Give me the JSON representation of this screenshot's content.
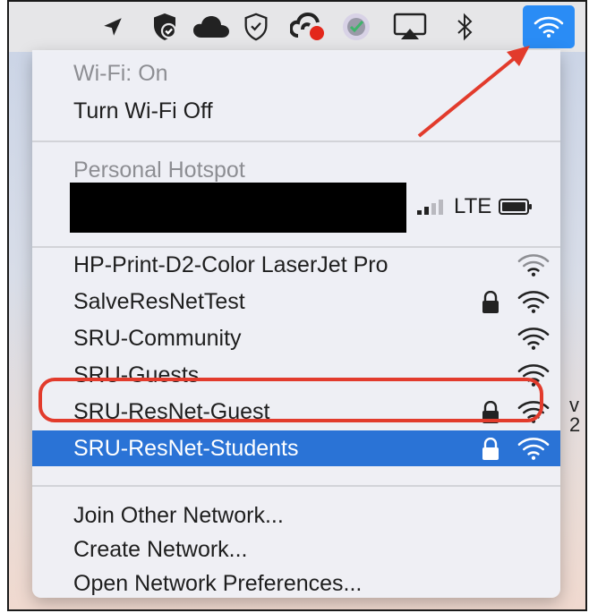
{
  "menubar": {
    "icons": [
      "location-icon",
      "shield-check-icon",
      "cloud-icon",
      "vpn-shield-icon",
      "creative-cloud-icon",
      "badge-app-icon",
      "airplay-icon",
      "bluetooth-icon",
      "wifi-icon"
    ]
  },
  "menu": {
    "status_label": "Wi-Fi: On",
    "toggle_label": "Turn Wi-Fi Off",
    "hotspot_header": "Personal Hotspot",
    "hotspot_network": "LTE",
    "networks": [
      {
        "name": "HP-Print-D2-Color LaserJet Pro",
        "locked": false
      },
      {
        "name": "SalveResNetTest",
        "locked": true
      },
      {
        "name": "SRU-Community",
        "locked": false
      },
      {
        "name": "SRU-Guests",
        "locked": false
      },
      {
        "name": "SRU-ResNet-Guest",
        "locked": true
      },
      {
        "name": "SRU-ResNet-Students",
        "locked": true,
        "selected": true
      }
    ],
    "join_other": "Join Other Network...",
    "create_network": "Create Network...",
    "open_prefs": "Open Network Preferences..."
  },
  "edge_text": [
    "v",
    "2"
  ],
  "colors": {
    "accent": "#2a73d6",
    "annotation": "#e23b2c"
  }
}
